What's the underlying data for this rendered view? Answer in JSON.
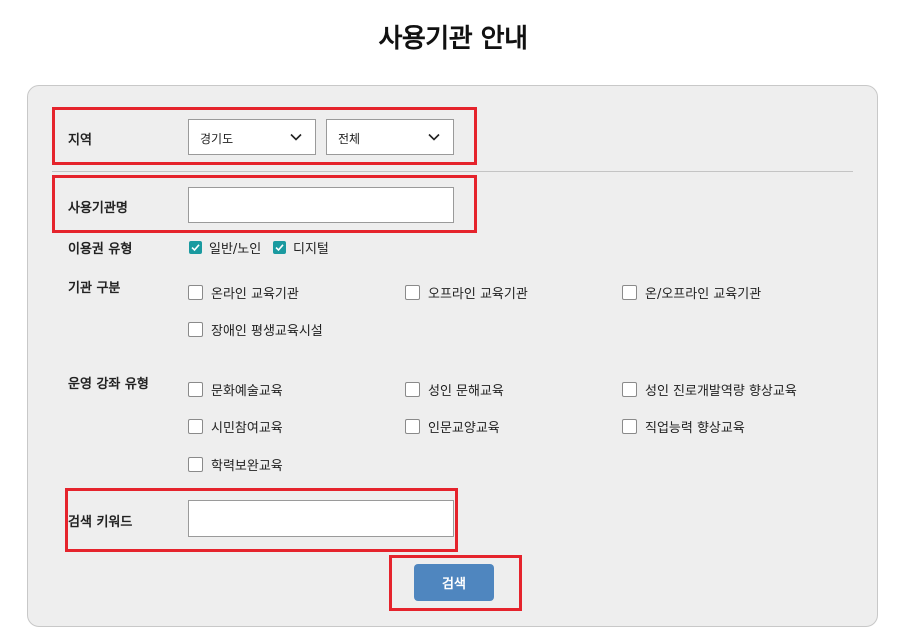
{
  "page": {
    "title": "사용기관 안내"
  },
  "form": {
    "region": {
      "label": "지역",
      "province": "경기도",
      "city": "전체"
    },
    "org_name": {
      "label": "사용기관명",
      "value": ""
    },
    "voucher_type": {
      "label": "이용권 유형",
      "options": [
        {
          "label": "일반/노인",
          "checked": true
        },
        {
          "label": "디지털",
          "checked": true
        }
      ]
    },
    "org_category": {
      "label": "기관 구분",
      "options": [
        {
          "label": "온라인 교육기관",
          "checked": false
        },
        {
          "label": "오프라인 교육기관",
          "checked": false
        },
        {
          "label": "온/오프라인 교육기관",
          "checked": false
        },
        {
          "label": "장애인 평생교육시설",
          "checked": false
        }
      ]
    },
    "course_type": {
      "label": "운영 강좌 유형",
      "options": [
        {
          "label": "문화예술교육",
          "checked": false
        },
        {
          "label": "성인 문해교육",
          "checked": false
        },
        {
          "label": "성인 진로개발역량 향상교육",
          "checked": false
        },
        {
          "label": "시민참여교육",
          "checked": false
        },
        {
          "label": "인문교양교육",
          "checked": false
        },
        {
          "label": "직업능력 향상교육",
          "checked": false
        },
        {
          "label": "학력보완교육",
          "checked": false
        }
      ]
    },
    "keyword": {
      "label": "검색 키워드",
      "value": ""
    },
    "search_button": "검색"
  },
  "colors": {
    "checkbox_checked": "#1a9aa0",
    "button": "#4f86bf",
    "highlight": "#e5232c",
    "panel": "#eeeeee"
  }
}
